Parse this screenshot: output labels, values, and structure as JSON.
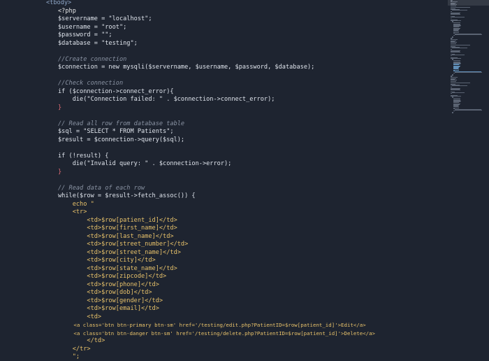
{
  "lines": [
    "<tbody>",
    "<?php",
    "$servername = \"localhost\";",
    "$username = \"root\";",
    "$password = \"\";",
    "$database = \"testing\";",
    "",
    "//Create connection",
    "$connection = new mysqli($servername, $username, $password, $database);",
    "",
    "//Check connection",
    "if ($connection->connect_error){",
    "    die(\"Connection failed: \" . $connection->connect_error);",
    "}",
    "",
    "// Read all row from database table",
    "$sql = \"SELECT * FROM Patients\";",
    "$result = $connection->query($sql);",
    "",
    "if (!result) {",
    "    die(\"Invalid query: \" . $connection->error);",
    "}",
    "",
    "// Read data of each row",
    "while($row = $result->fetch_assoc()) {",
    "    echo \"",
    "    <tr>",
    "        <td>$row[patient_id]</td>",
    "        <td>$row[first_name]</td>",
    "        <td>$row[last_name]</td>",
    "        <td>$row[street_number]</td>",
    "        <td>$row[street_name]</td>",
    "        <td>$row[city]</td>",
    "        <td>$row[state_name]</td>",
    "        <td>$row[zipcode]</td>",
    "        <td>$row[phone]</td>",
    "        <td>$row[dob]</td>",
    "        <td>$row[gender]</td>",
    "        <td>$row[email]</td>",
    "        <td>",
    "            <a class='btn btn-primary btn-sm' href='/testing/edit.php?PatientID=$row[patient_id]'>Edit</a>",
    "            <a class='btn btn-danger btn-sm' href='/testing/delete.php?PatientID=$row[patient_id]'>Delete</a>",
    "        </td>",
    "    </tr>",
    "    \";"
  ],
  "colors": {
    "background": "#1e2430",
    "comment": "#8a93a3",
    "keyword": "#e06c75",
    "function": "#e8c26a",
    "class": "#5fb3e0",
    "tag": "#8fa7c8"
  }
}
